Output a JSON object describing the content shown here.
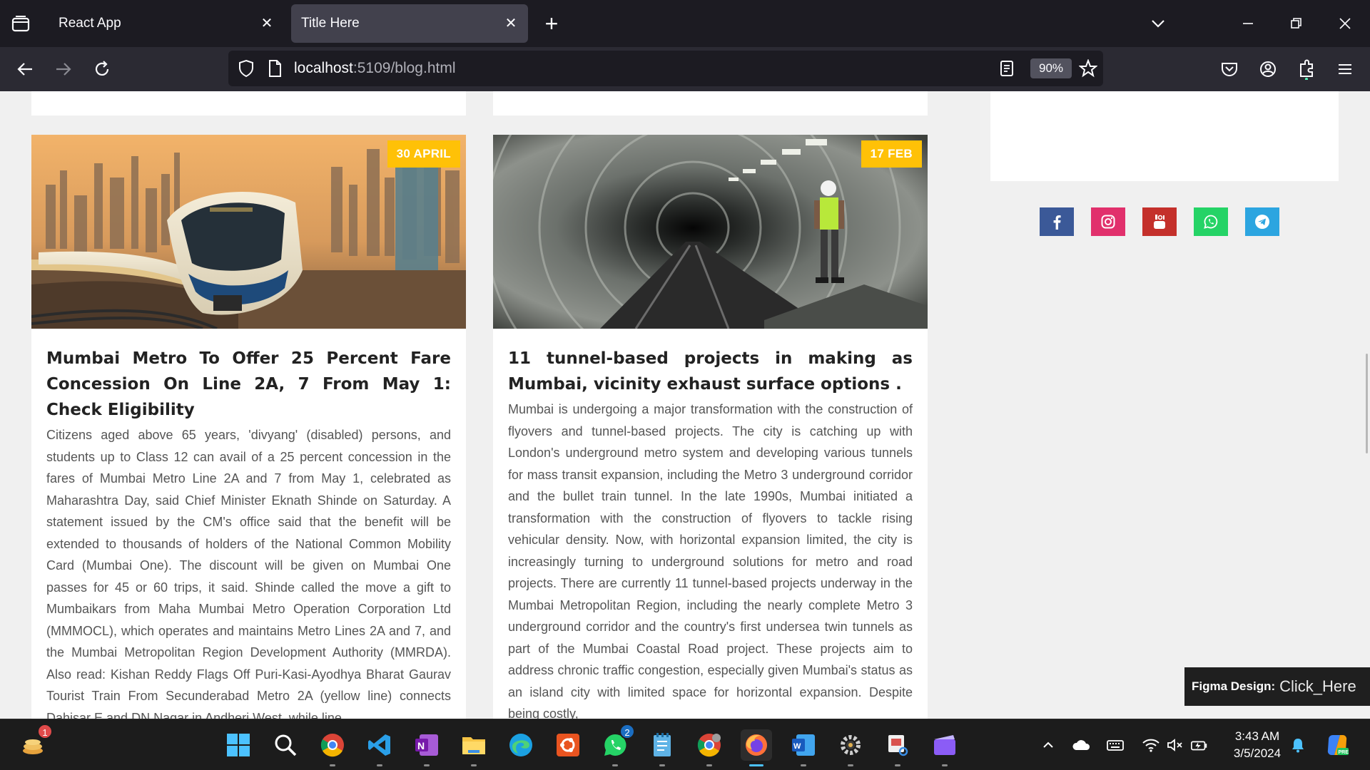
{
  "browser": {
    "tabs": [
      {
        "title": "React App"
      },
      {
        "title": "Title Here"
      }
    ],
    "url_host": "localhost",
    "url_rest": ":5109/blog.html",
    "zoom": "90%"
  },
  "posts": [
    {
      "date": "30 APRIL",
      "title": "Mumbai Metro To Offer 25 Percent Fare Concession On Line 2A, 7 From May 1: Check Eligibility",
      "body": "Citizens aged above 65 years, 'divyang' (disabled) persons, and students up to Class 12 can avail of a 25 percent concession in the fares of Mumbai Metro Line 2A and 7 from May 1, celebrated as Maharashtra Day, said Chief Minister Eknath Shinde on Saturday. A statement issued by the CM's office said that the benefit will be extended to thousands of holders of the National Common Mobility Card (Mumbai One). The discount will be given on Mumbai One passes for 45 or 60 trips, it said. Shinde called the move a gift to Mumbaikars from Maha Mumbai Metro Operation Corporation Ltd (MMMOCL), which operates and maintains Metro Lines 2A and 7, and the Mumbai Metropolitan Region Development Authority (MMRDA). Also read: Kishan Reddy Flags Off Puri-Kasi-Ayodhya Bharat Gaurav Tourist Train From Secunderabad Metro 2A (yellow line) connects Dahisar E and DN Nagar in Andheri West, while line"
    },
    {
      "date": "17 FEB",
      "title": "11 tunnel-based projects in making as Mumbai, vicinity exhaust surface options .",
      "body": "Mumbai is undergoing a major transformation with the construction of flyovers and tunnel-based projects. The city is catching up with London's underground metro system and developing various tunnels for mass transit expansion, including the Metro 3 underground corridor and the bullet train tunnel. In the late 1990s, Mumbai initiated a transformation with the construction of flyovers to tackle rising vehicular density. Now, with horizontal expansion limited, the city is increasingly turning to underground solutions for metro and road projects. There are currently 11 tunnel-based projects underway in the Mumbai Metropolitan Region, including the nearly complete Metro 3 underground corridor and the country's first undersea twin tunnels as part of the Mumbai Coastal Road project. These projects aim to address chronic traffic congestion, especially given Mumbai's status as an island city with limited space for horizontal expansion. Despite being costly,"
    }
  ],
  "socials": [
    {
      "icon": "facebook-icon",
      "color": "#3b5998"
    },
    {
      "icon": "instagram-icon",
      "color": "#e1306c"
    },
    {
      "icon": "youtube-icon",
      "color": "#c4302b"
    },
    {
      "icon": "whatsapp-icon",
      "color": "#25d366"
    },
    {
      "icon": "telegram-icon",
      "color": "#2ca5e0"
    }
  ],
  "figma": {
    "label": "Figma Design:",
    "link": "Click_Here"
  },
  "taskbar": {
    "time": "3:43 AM",
    "date": "3/5/2024",
    "whatsapp_badge": "2",
    "widgets_badge": "1"
  }
}
